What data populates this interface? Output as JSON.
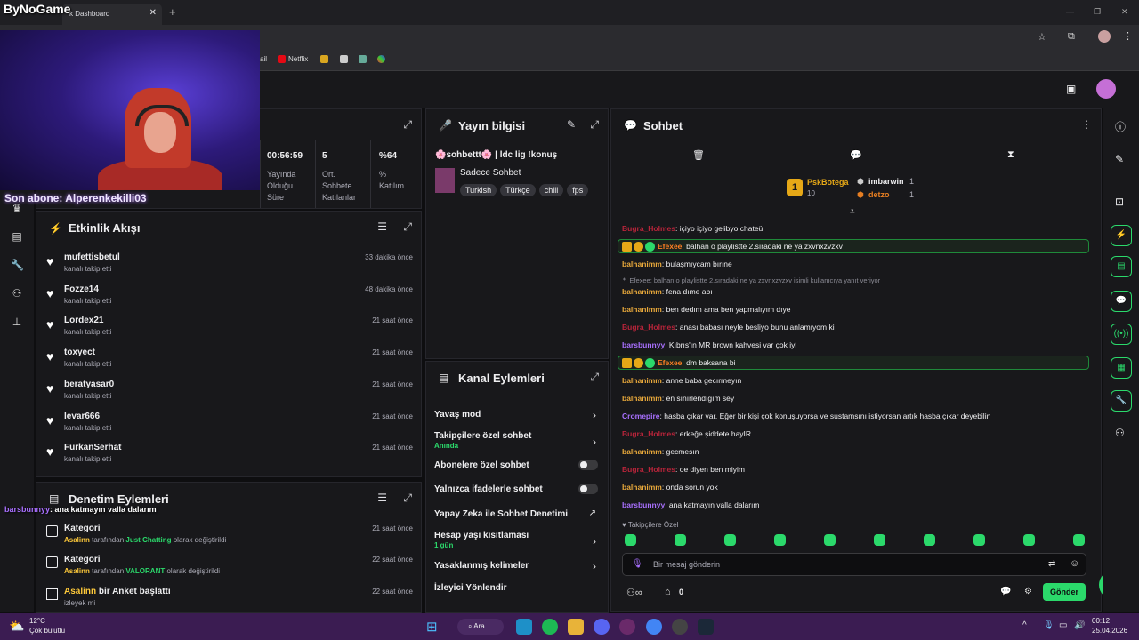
{
  "browser": {
    "overlay_brand": "ByNoGame",
    "tab_title": "k Dashboard",
    "bookmarks": [
      {
        "label": "ail"
      },
      {
        "label": "Netflix"
      }
    ]
  },
  "overlay": {
    "last_sub": "Son abone: Alperenkekilli03",
    "chat_overlay_user": "barsbunnyy",
    "chat_overlay_text": ": ana katmayın valla dalarım"
  },
  "stats": {
    "uptime_value": "00:56:59",
    "uptime_label1": "Yayında",
    "uptime_label2": "Olduğu",
    "uptime_label3": "Süre",
    "avg_value": "5",
    "avg_label1": "Ort.",
    "avg_label2": "Sohbete",
    "avg_label3": "Katılanlar",
    "part_value": "%64",
    "part_label1": "%",
    "part_label2": "Katılım"
  },
  "activity": {
    "title": "Etkinlik Akışı",
    "items": [
      {
        "name": "mufettisbetul",
        "sub": "kanalı takip etti",
        "time": "33 dakika önce"
      },
      {
        "name": "Fozze14",
        "sub": "kanalı takip etti",
        "time": "48 dakika önce"
      },
      {
        "name": "Lordex21",
        "sub": "kanalı takip etti",
        "time": "21 saat önce"
      },
      {
        "name": "toxyect",
        "sub": "kanalı takip etti",
        "time": "21 saat önce"
      },
      {
        "name": "beratyasar0",
        "sub": "kanalı takip etti",
        "time": "21 saat önce"
      },
      {
        "name": "levar666",
        "sub": "kanalı takip etti",
        "time": "21 saat önce"
      },
      {
        "name": "FurkanSerhat",
        "sub": "kanalı takip etti",
        "time": "21 saat önce"
      }
    ]
  },
  "modactions": {
    "title": "Denetim Eylemleri",
    "items": [
      {
        "name": "Kategori",
        "actor": "Asalinn",
        "mid": " tarafından ",
        "value": "Just Chatting",
        "end": " olarak değiştirildi",
        "time": "21 saat önce"
      },
      {
        "name": "Kategori",
        "actor": "Asalinn",
        "mid": " tarafından ",
        "value": "VALORANT",
        "end": " olarak değiştirildi",
        "time": "22 saat önce"
      },
      {
        "actor": "Asalinn",
        "name": " bir Anket başlattı",
        "sub": "izleyek mi",
        "time": "22 saat önce"
      }
    ]
  },
  "streaminfo": {
    "title": "Yayın bilgisi",
    "stream_title": "🌸sohbettt🌸 | ldc lig !konuş",
    "category": "Sadece Sohbet",
    "tags": [
      "Turkish",
      "Türkçe",
      "chill",
      "fps"
    ]
  },
  "channelactions": {
    "title": "Kanal Eylemleri",
    "items": [
      {
        "label": "Yavaş mod"
      },
      {
        "label": "Takipçilere özel sohbet",
        "sub": "Anında"
      },
      {
        "label": "Abonelere özel sohbet"
      },
      {
        "label": "Yalnızca ifadelerle sohbet"
      },
      {
        "label": "Yapay Zeka ile Sohbet Denetimi"
      },
      {
        "label": "Hesap yaşı kısıtlaması",
        "sub": "1 gün"
      },
      {
        "label": "Yasaklanmış kelimeler"
      },
      {
        "label": "İzleyici Yönlendir"
      }
    ]
  },
  "chat": {
    "title": "Sohbet",
    "leaderboard": {
      "first_name": "PskBotega",
      "first_count": "10",
      "second_name": "imbarwin",
      "second_count": "1",
      "third_name": "detzo",
      "third_count": "1"
    },
    "messages": [
      {
        "user": "Bugra_Holmes",
        "text": ": içiyo içiyo gelibyo chateü",
        "color": "red"
      },
      {
        "user": "Efexee",
        "text": ": balhan o playlistte 2.sıradaki ne ya zxvnxzvzxv",
        "color": "orange",
        "highlight": true
      },
      {
        "user": "balhanimm",
        "text": ": bulaşmıycam bırıne",
        "color": "gold"
      },
      {
        "reply": "↰ Efexee: balhan o playlistte 2.sıradaki ne ya zxvnxzvzxv isimli kullanıcıya yanıt veriyor"
      },
      {
        "user": "balhanimm",
        "text": ": fena dıme abı",
        "color": "gold"
      },
      {
        "user": "balhanimm",
        "text": ": ben dedım ama ben yapmalıyım dıye",
        "color": "gold"
      },
      {
        "user": "Bugra_Holmes",
        "text": ": anası babası neyle besliyo bunu anlamıyom ki",
        "color": "red"
      },
      {
        "user": "barsbunnyy",
        "text": ": Kıbrıs'ın MR brown kahvesi var çok iyi",
        "color": "purp"
      },
      {
        "user": "Efexee",
        "text": ": dm baksana bi",
        "color": "orange",
        "highlight": true
      },
      {
        "user": "balhanimm",
        "text": ": anne baba gecırmeyın",
        "color": "gold"
      },
      {
        "user": "balhanimm",
        "text": ": en sınırlendıgım sey",
        "color": "gold"
      },
      {
        "user": "Cromepire",
        "text": ": hasba çıkar var. Eğer bir kişi çok konuşuyorsa ve sustamsını istiyorsan artık hasba çıkar deyebilin",
        "color": "purp"
      },
      {
        "user": "Bugra_Holmes",
        "text": ": erkeğe şiddete hayIR",
        "color": "red"
      },
      {
        "user": "balhanimm",
        "text": ": gecmesın",
        "color": "gold"
      },
      {
        "user": "Bugra_Holmes",
        "text": ": oe diyen ben miyim",
        "color": "red"
      },
      {
        "user": "balhanimm",
        "text": ": onda sorun yok",
        "color": "gold"
      },
      {
        "user": "barsbunnyy",
        "text": ": ana katmayın valla dalarım",
        "color": "purp"
      }
    ],
    "followers_only": "Takipçilere Özel",
    "input_placeholder": "Bir mesaj gönderin",
    "points": "0",
    "send_label": "Gönder"
  },
  "taskbar": {
    "weather_temp": "12°C",
    "weather_desc": "Çok bulutlu",
    "search": "Ara",
    "time": "00:12",
    "date": "25.04.2026"
  },
  "colors": {
    "accent_green": "#2bd96b",
    "twitch_bg": "#18181b",
    "taskbar": "#3b1c52"
  }
}
